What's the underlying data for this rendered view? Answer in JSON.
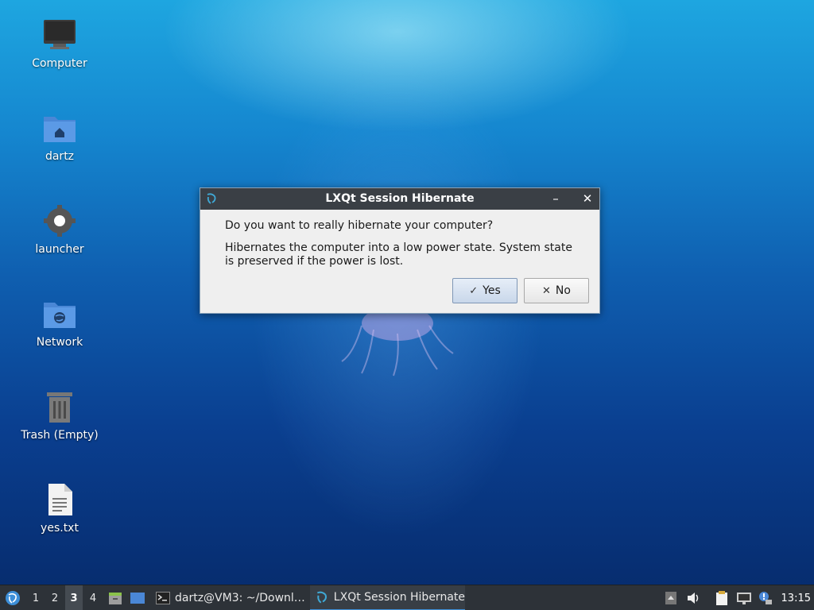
{
  "desktop": {
    "icons": [
      {
        "label": "Computer",
        "icon": "computer-icon"
      },
      {
        "label": "dartz",
        "icon": "home-folder-icon"
      },
      {
        "label": "launcher",
        "icon": "gear-icon"
      },
      {
        "label": "Network",
        "icon": "network-folder-icon"
      },
      {
        "label": "Trash (Empty)",
        "icon": "trash-icon"
      },
      {
        "label": "yes.txt",
        "icon": "text-file-icon"
      }
    ]
  },
  "dialog": {
    "title": "LXQt Session Hibernate",
    "minimize_glyph": "–",
    "close_glyph": "✕",
    "question": "Do you want to really hibernate your computer?",
    "description": "Hibernates the computer into a low power state. System state is preserved if the power is lost.",
    "yes_label": "Yes",
    "no_label": "No",
    "yes_glyph": "✓",
    "no_glyph": "✕"
  },
  "taskbar": {
    "workspaces": [
      "1",
      "2",
      "3",
      "4"
    ],
    "active_workspace": "3",
    "tasks": [
      {
        "label": "dartz@VM3: ~/Downl…",
        "icon": "terminal-icon",
        "active": false
      },
      {
        "label": "LXQt Session Hibernate",
        "icon": "lxqt-icon",
        "active": true
      }
    ],
    "clock": "13:15"
  },
  "colors": {
    "taskbar_bg": "#2d3238",
    "titlebar_bg": "#3a3f45",
    "accent": "#3d8fd8",
    "dialog_bg": "#efefef"
  }
}
